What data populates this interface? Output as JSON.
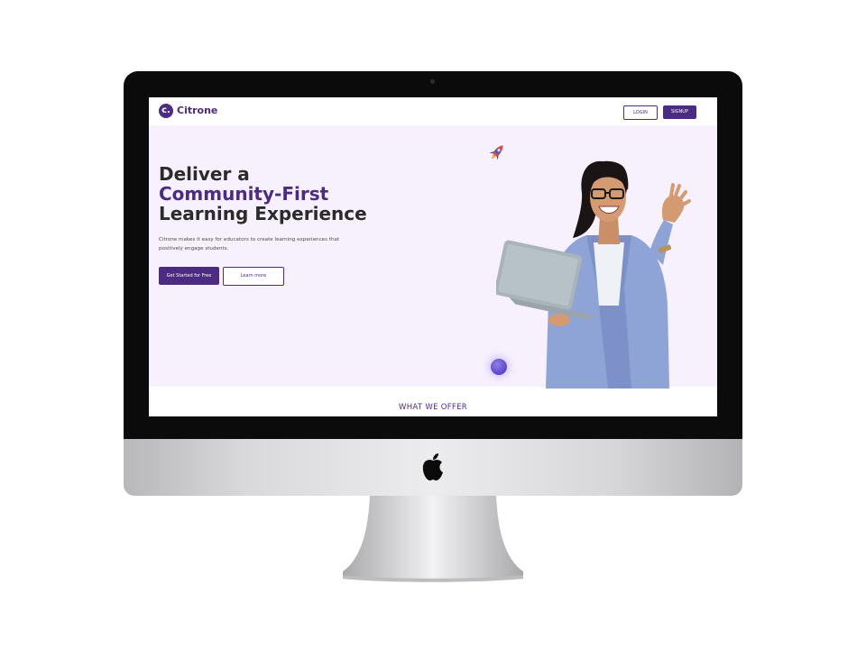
{
  "site": {
    "logo_mark": "c.",
    "brand_name": "Citrone"
  },
  "nav": {
    "login_label": "LOGIN",
    "signup_label": "SIGNUP"
  },
  "hero": {
    "headline_line1": "Deliver a",
    "headline_line2": "Community-First",
    "headline_line3": "Learning Experience",
    "description": "Citrone makes it easy for educators to create learning experiences that positively engage students.",
    "primary_cta": "Get Started for Free",
    "secondary_cta": "Learn more"
  },
  "section": {
    "what_we_offer": "WHAT WE OFFER"
  },
  "colors": {
    "brand_purple": "#4b2c82",
    "hero_background": "#f7f1fd",
    "monitor_bezel": "#0b0b0b"
  },
  "icons": [
    "apple-logo-icon",
    "rocket-icon",
    "orb-icon"
  ]
}
